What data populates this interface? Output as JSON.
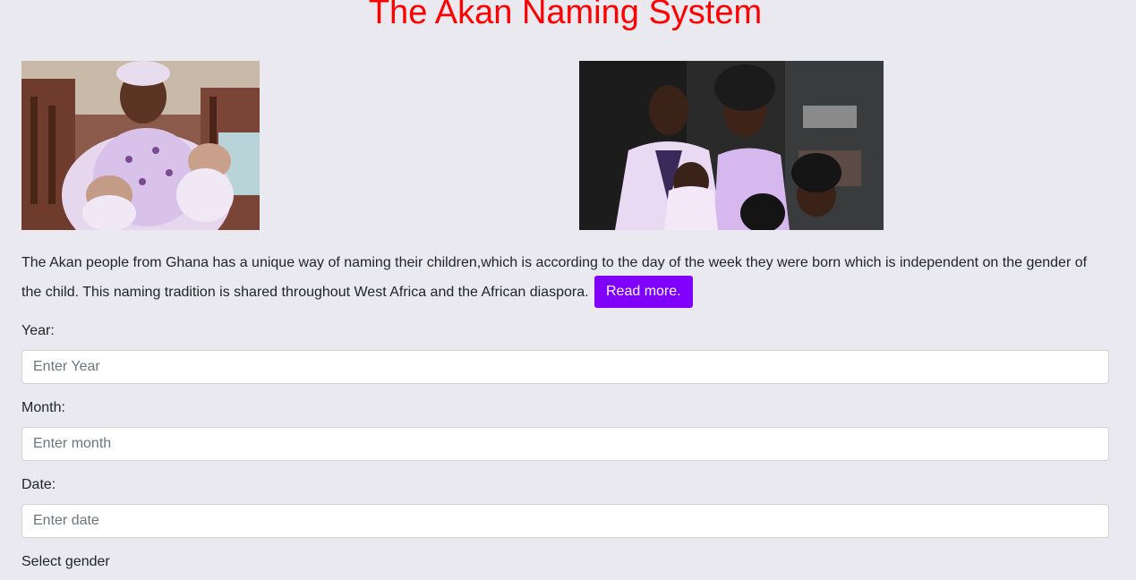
{
  "header": {
    "title": "The Akan Naming System"
  },
  "intro": {
    "text": "The Akan people from Ghana has a unique way of naming their children,which is according to the day of the week they were born which is independent on the gender of the child. This naming tradition is shared throughout West Africa and the African diaspora.",
    "read_more_label": "Read more."
  },
  "form": {
    "year_label": "Year:",
    "year_placeholder": "Enter Year",
    "month_label": "Month:",
    "month_placeholder": "Enter month",
    "date_label": "Date:",
    "date_placeholder": "Enter date",
    "gender_label": "Select gender"
  },
  "colors": {
    "background": "#e9e9ef",
    "title": "#ff0000",
    "button": "#7f00ff"
  }
}
